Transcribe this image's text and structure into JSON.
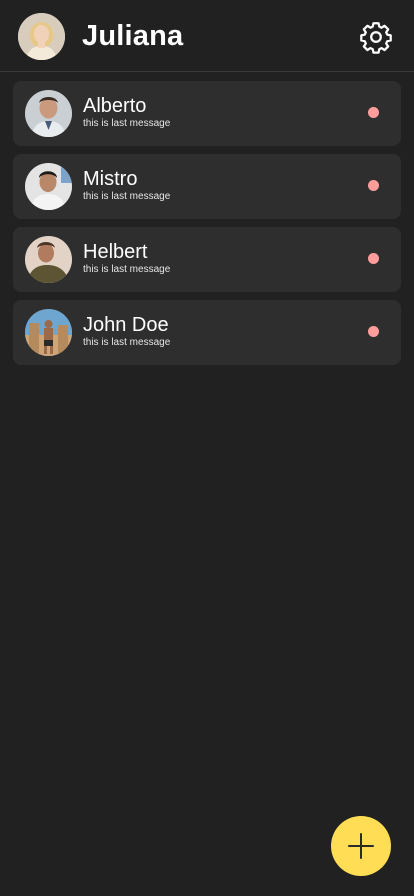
{
  "header": {
    "title": "Juliana",
    "profile_avatar_icon": "user-avatar",
    "settings_icon": "gear-icon"
  },
  "conversations": [
    {
      "name": "Alberto",
      "last_message": "this is last message",
      "unread": true
    },
    {
      "name": "Mistro",
      "last_message": "this is last message",
      "unread": true
    },
    {
      "name": "Helbert",
      "last_message": "this is last message",
      "unread": true
    },
    {
      "name": "John Doe",
      "last_message": "this is last message",
      "unread": true
    }
  ],
  "fab": {
    "icon": "plus-icon"
  },
  "colors": {
    "background": "#212121",
    "card": "#2e2e2e",
    "unread_dot": "#ff9d9d",
    "fab": "#ffdd55"
  }
}
